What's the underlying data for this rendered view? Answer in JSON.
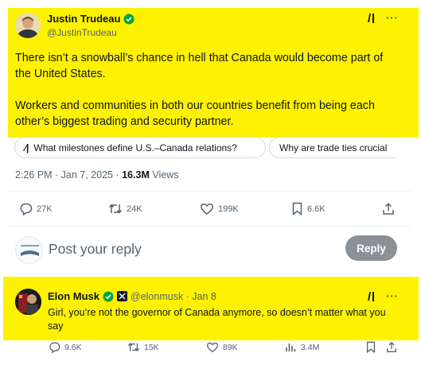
{
  "tweet": {
    "author_name": "Justin Trudeau",
    "handle": "@JustinTrudeau",
    "paragraph1": "There isn’t a snowball’s chance in hell that Canada would become part of the United States.",
    "paragraph2": "Workers and communities in both our countries benefit from being each other’s biggest trading and security partner.",
    "grok_chip_1": "What milestones define U.S.–Canada relations?",
    "grok_chip_2": "Why are trade ties crucial",
    "time": "2:26 PM · Jan 7, 2025 · ",
    "views_count": "16.3M",
    "views_label": " Views",
    "replies": "27K",
    "reposts": "24K",
    "likes": "199K",
    "bookmarks": "6.6K"
  },
  "composer": {
    "placeholder": "Post your reply",
    "reply_label": "Reply"
  },
  "reply": {
    "author_name": "Elon Musk",
    "handle_date": "@elonmusk · Jan 8",
    "text": "Girl, you’re not the governor of Canada anymore, so doesn’t matter what you say",
    "replies": "9.6K",
    "reposts": "15K",
    "likes": "89K",
    "views": "3.4M"
  },
  "icons": {
    "grok": "grok-icon",
    "more": "more-icon",
    "verified": "verified-badge-icon",
    "x_affiliate": "x-affiliate-icon",
    "reply": "reply-icon",
    "repost": "repost-icon",
    "like": "like-icon",
    "bookmark": "bookmark-icon",
    "share": "share-icon",
    "views": "views-icon"
  },
  "colors": {
    "highlight": "#fff200",
    "verified_green": "#00a63e",
    "muted_text": "#536471",
    "reply_button": "#8b9196"
  }
}
